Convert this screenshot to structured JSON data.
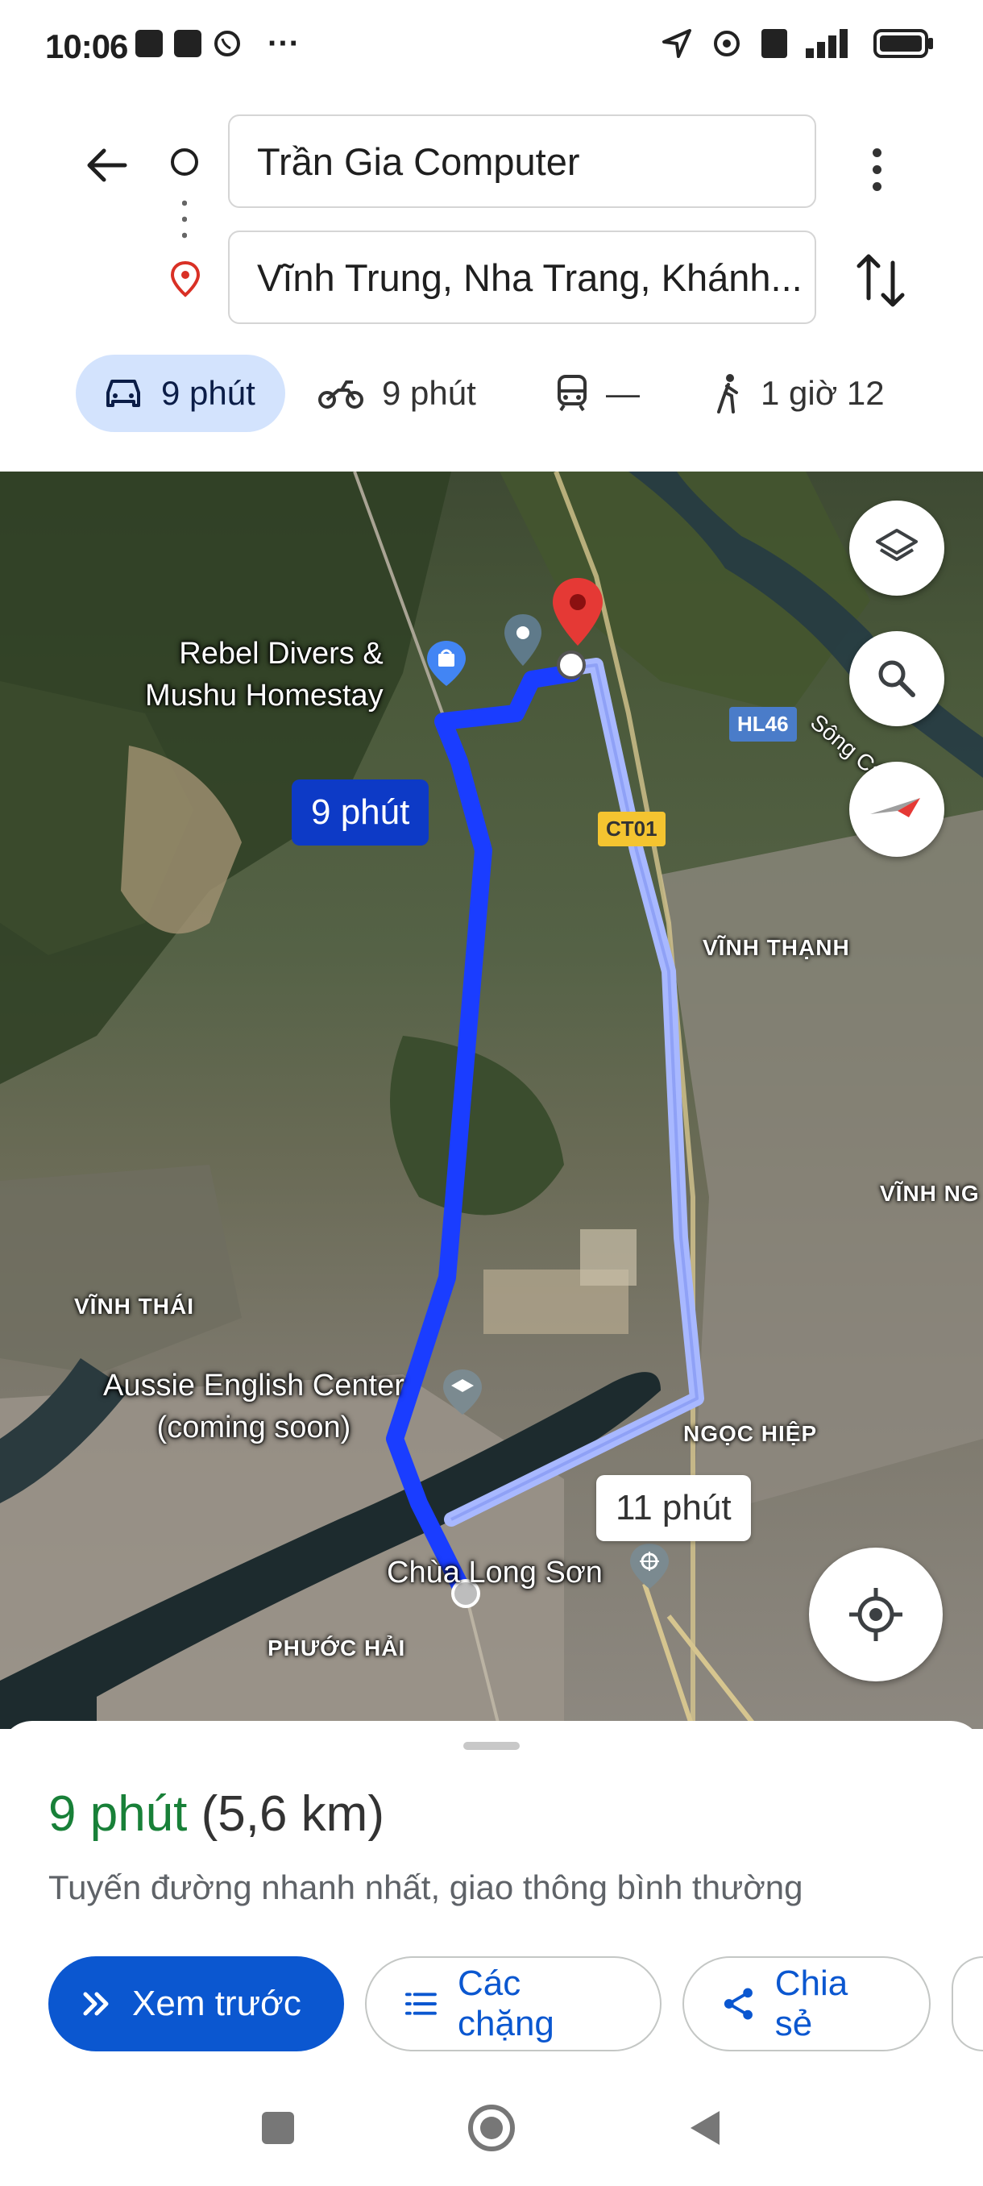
{
  "status_bar": {
    "time": "10:06",
    "overflow": "···"
  },
  "directions": {
    "origin": "Trần Gia Computer",
    "destination": "Vĩnh Trung, Nha Trang, Khánh..."
  },
  "modes": [
    {
      "id": "drive",
      "icon": "car-icon",
      "label": "9 phút",
      "selected": true
    },
    {
      "id": "motorbike",
      "icon": "motorbike-icon",
      "label": "9 phút"
    },
    {
      "id": "transit",
      "icon": "train-icon",
      "label": "—"
    },
    {
      "id": "walk",
      "icon": "walk-icon",
      "label": "1 giờ 12"
    }
  ],
  "map": {
    "poi": {
      "rebel": "Rebel Divers &\nMushu Homestay",
      "aussie": "Aussie English Center\n(coming soon)",
      "chua": "Chùa Long Sơn"
    },
    "areas": {
      "vinh_thanh": "VĨNH THẠNH",
      "vinh_thai": "VĨNH THÁI",
      "ngoc_hiep": "NGỌC HIỆP",
      "phuoc_hai": "PHƯỚC HẢI",
      "vinh_ng": "VĨNH NG"
    },
    "river": "Sông Cái",
    "road_badges": {
      "hl46": "HL46",
      "ct01": "CT01"
    },
    "route_primary_time": "9 phút",
    "route_alt_time": "11 phút",
    "colors": {
      "primary_route": "#1a3dff",
      "alt_route": "#a8b8ff",
      "pin": "#e53935"
    }
  },
  "sheet": {
    "duration": "9 phút",
    "distance": "(5,6 km)",
    "description": "Tuyến đường nhanh nhất, giao thông bình thường",
    "buttons": {
      "preview": "Xem trước",
      "steps": "Các chặng",
      "share": "Chia sẻ"
    }
  }
}
